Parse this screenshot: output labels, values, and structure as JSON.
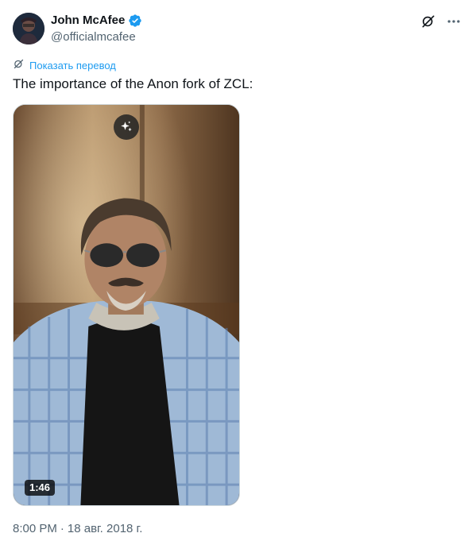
{
  "author": {
    "name": "John McAfee",
    "handle": "@officialmcafee"
  },
  "translate_link": "Показать перевод",
  "tweet_text": "The importance of the Anon fork of ZCL:",
  "media": {
    "duration": "1:46"
  },
  "timestamp": {
    "time": "8:00 PM",
    "separator": "·",
    "date": "18 авг. 2018 г."
  },
  "colors": {
    "accent": "#1d9bf0",
    "secondary_text": "#536471",
    "primary_text": "#0f1419"
  },
  "icons": [
    "verified-badge-icon",
    "grok-icon",
    "more-icon",
    "translate-icon",
    "sparkle-icon"
  ]
}
